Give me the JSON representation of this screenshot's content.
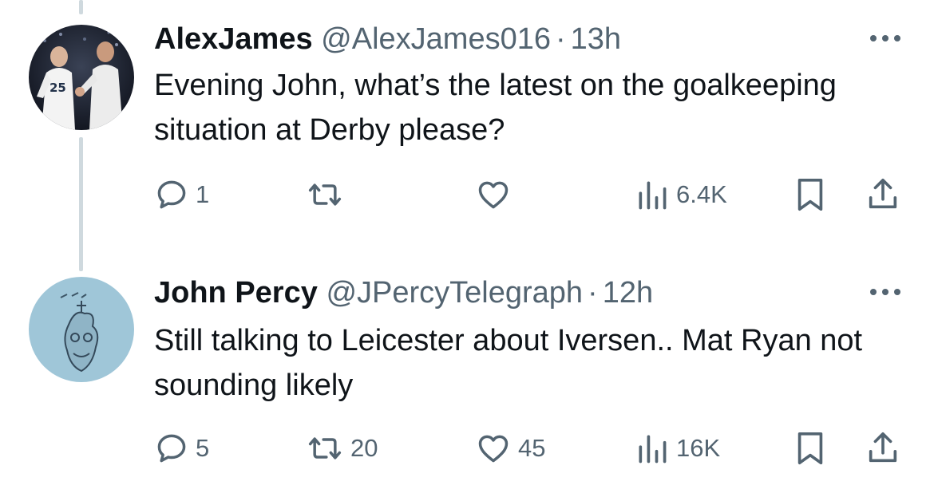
{
  "tweets": [
    {
      "name": "AlexJames",
      "handle": "@AlexJames016",
      "separator": "·",
      "time": "13h",
      "text": "Evening John, what’s the latest on the goalkeeping situation at Derby please?",
      "avatar_jersey_number": "25",
      "replies": "1",
      "retweets": "",
      "likes": "",
      "views": "6.4K"
    },
    {
      "name": "John Percy",
      "handle": "@JPercyTelegraph",
      "separator": "·",
      "time": "12h",
      "text": "Still talking to Leicester about Iversen.. Mat Ryan not sounding likely",
      "replies": "5",
      "retweets": "20",
      "likes": "45",
      "views": "16K"
    }
  ],
  "icons": {
    "reply": "reply-icon",
    "retweet": "retweet-icon",
    "like": "heart-icon",
    "views": "views-icon",
    "bookmark": "bookmark-icon",
    "share": "share-icon",
    "more": "more-icon"
  },
  "colors": {
    "text": "#0f1419",
    "secondary": "#536471",
    "thread_line": "#cfd9de",
    "background": "#ffffff"
  }
}
